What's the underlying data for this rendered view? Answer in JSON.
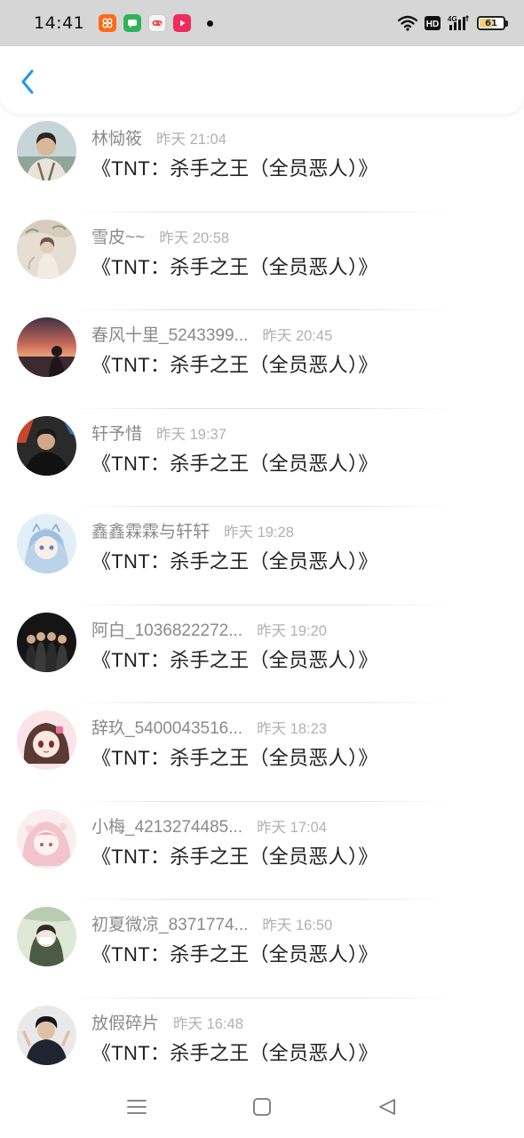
{
  "status_bar": {
    "time": "14:41",
    "battery_level": "61",
    "network": "4G",
    "hd_label": "HD"
  },
  "header": {
    "back_icon": "chevron-left-icon",
    "accent_color": "#2196f3"
  },
  "items": [
    {
      "name": "林恸筱",
      "time": "昨天 21:04",
      "message": "《TNT：杀手之王（全员恶人）》"
    },
    {
      "name": "雪皮~~",
      "time": "昨天 20:58",
      "message": "《TNT：杀手之王（全员恶人）》"
    },
    {
      "name": "春风十里_5243399...",
      "time": "昨天 20:45",
      "message": "《TNT：杀手之王（全员恶人）》"
    },
    {
      "name": "轩予惜",
      "time": "昨天 19:37",
      "message": "《TNT：杀手之王（全员恶人）》"
    },
    {
      "name": "鑫鑫霖霖与轩轩",
      "time": "昨天 19:28",
      "message": "《TNT：杀手之王（全员恶人）》"
    },
    {
      "name": "阿白_1036822272...",
      "time": "昨天 19:20",
      "message": "《TNT：杀手之王（全员恶人）》"
    },
    {
      "name": "辞玖_5400043516...",
      "time": "昨天 18:23",
      "message": "《TNT：杀手之王（全员恶人）》"
    },
    {
      "name": "小梅_4213274485...",
      "time": "昨天 17:04",
      "message": "《TNT：杀手之王（全员恶人）》"
    },
    {
      "name": "初夏微凉_8371774...",
      "time": "昨天 16:50",
      "message": "《TNT：杀手之王（全员恶人）》"
    },
    {
      "name": "放假碎片",
      "time": "昨天 16:48",
      "message": "《TNT：杀手之王（全员恶人）》"
    }
  ],
  "nav": {
    "menu_icon": "menu-icon",
    "home_icon": "home-icon",
    "back_icon": "back-triangle-icon"
  }
}
